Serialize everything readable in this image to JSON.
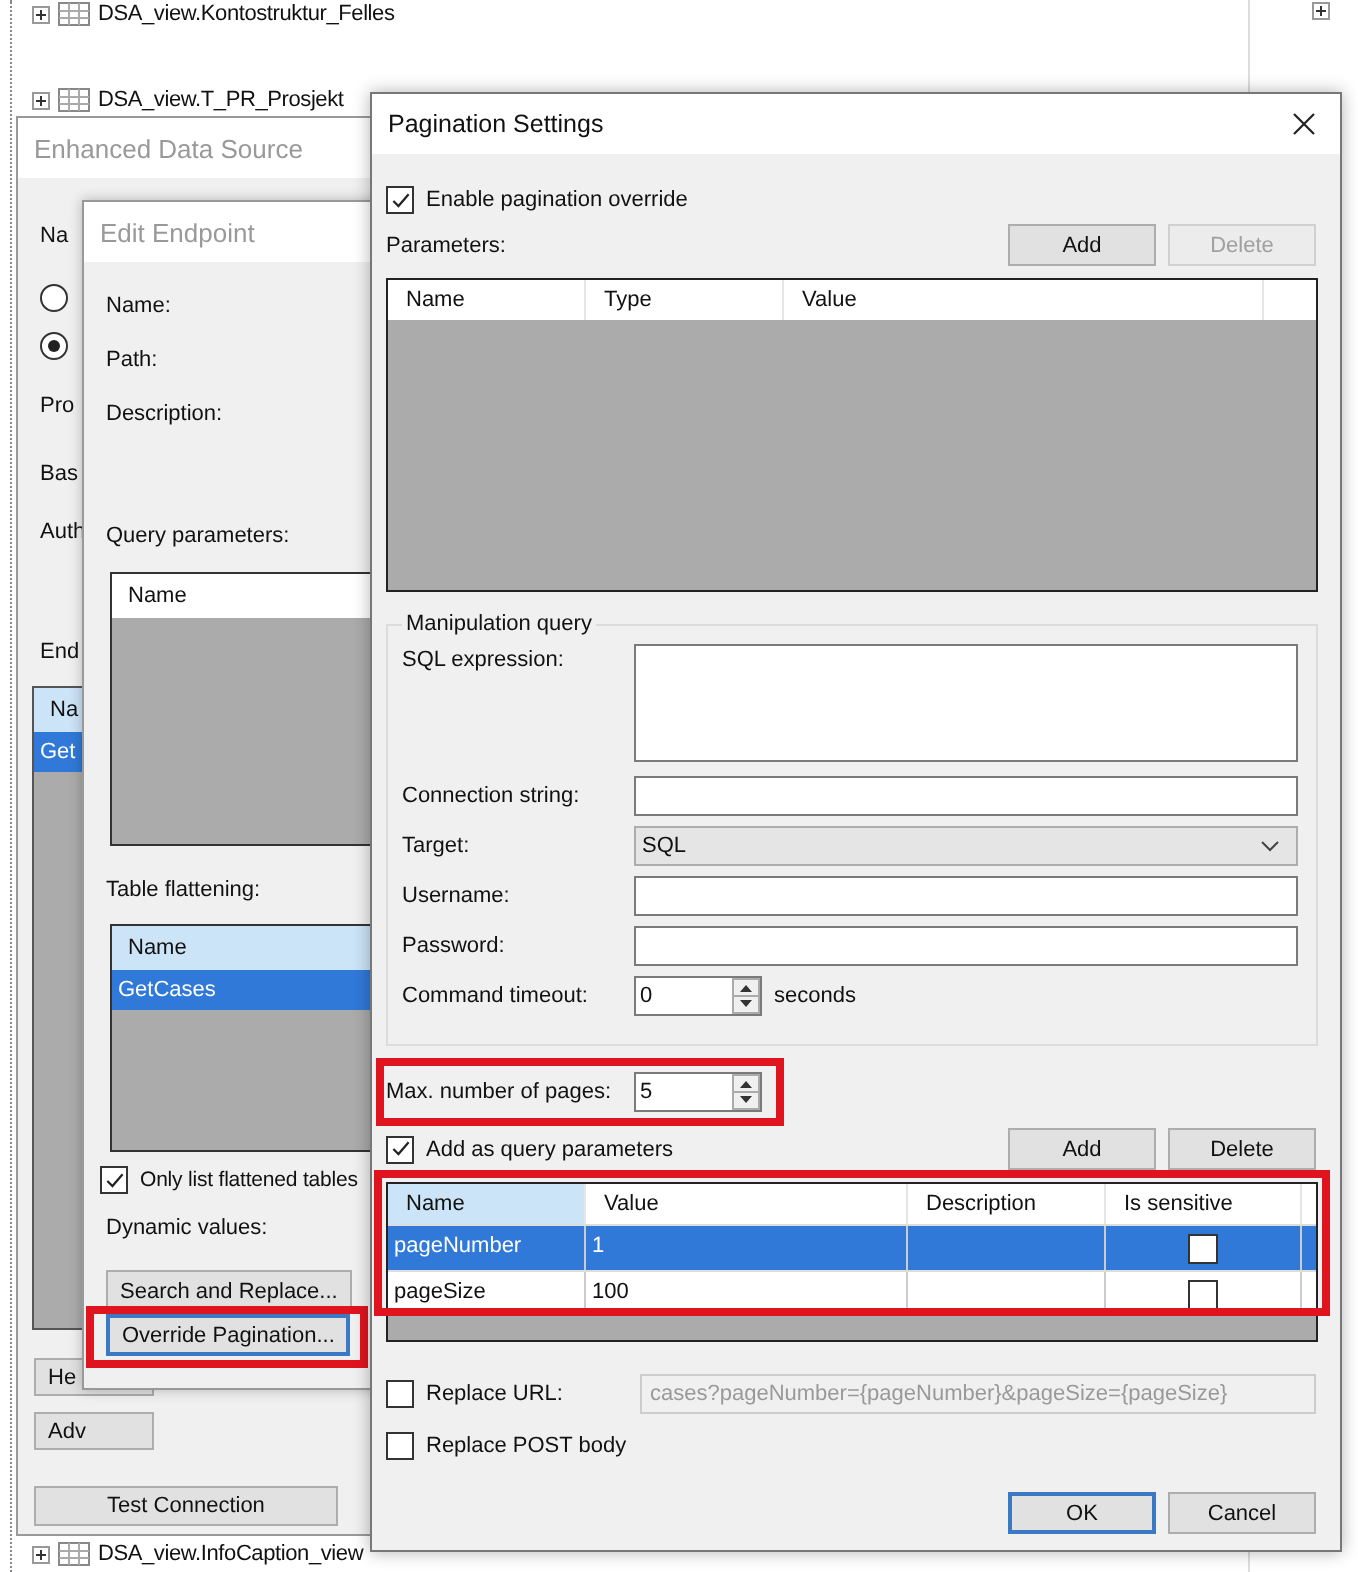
{
  "tree_items": [
    {
      "label": "DSA_view.Kontostruktur_Felles"
    },
    {
      "label": "DSA_view.T_PR_Prosjekt"
    },
    {
      "label": "DSA_view.InfoCaption_view"
    }
  ],
  "enhanced_data_source": {
    "title": "Enhanced Data Source",
    "name_label": "Na",
    "radios": [
      {
        "selected": false
      },
      {
        "selected": true
      }
    ],
    "provider_label": "Pro",
    "base_label": "Bas",
    "auth_label": "Auth",
    "endpoints_label": "End",
    "endpoints": {
      "column": "Na",
      "rows": [
        {
          "name": "Get",
          "selected": true
        }
      ]
    },
    "buttons": [
      "He",
      "Adv"
    ],
    "test_button": "Test Connection"
  },
  "edit_endpoint": {
    "title": "Edit Endpoint",
    "labels": [
      "Name:",
      "Path:",
      "Description:"
    ],
    "query_label": "Query parameters:",
    "query_column": "Name",
    "flattening_label": "Table flattening:",
    "flattening": {
      "column": "Name",
      "rows": [
        {
          "name": "GetCases",
          "selected": true
        }
      ]
    },
    "only_flattened": {
      "label": "Only list flattened tables",
      "checked": true
    },
    "dynamic_label": "Dynamic values:",
    "buttons": [
      {
        "label": "Search and Replace...",
        "highlighted": false
      },
      {
        "label": "Override Pagination...",
        "highlighted": true
      }
    ]
  },
  "pagination_settings": {
    "title": "Pagination Settings",
    "enable_override": {
      "label": "Enable pagination override",
      "checked": true
    },
    "parameters_label": "Parameters:",
    "parameter_buttons": [
      {
        "label": "Add",
        "disabled": false
      },
      {
        "label": "Delete",
        "disabled": true
      }
    ],
    "parameters_table": {
      "columns": [
        "Name",
        "Type",
        "Value"
      ]
    },
    "manipulation_query": {
      "title": "Manipulation query",
      "fields": [
        {
          "kind": "textarea",
          "label": "SQL expression:"
        },
        {
          "kind": "text",
          "label": "Connection string:"
        },
        {
          "kind": "select",
          "label": "Target:",
          "value": "SQL"
        },
        {
          "kind": "text",
          "label": "Username:"
        },
        {
          "kind": "text",
          "label": "Password:"
        },
        {
          "kind": "spinner",
          "label": "Command timeout:",
          "value": "0",
          "unit": "seconds"
        }
      ]
    },
    "max_pages": {
      "label": "Max. number of pages:",
      "value": "5",
      "highlighted": true
    },
    "add_as_query": {
      "label": "Add as query parameters",
      "checked": true
    },
    "query_buttons": [
      {
        "label": "Add",
        "disabled": false
      },
      {
        "label": "Delete",
        "disabled": false
      }
    ],
    "query_table": {
      "highlighted": true,
      "columns": [
        "Name",
        "Value",
        "Description",
        "Is sensitive"
      ],
      "rows": [
        {
          "name": "pageNumber",
          "value": "1",
          "sensitive": false,
          "selected": true
        },
        {
          "name": "pageSize",
          "value": "100",
          "sensitive": false,
          "selected": false
        }
      ]
    },
    "replace_url": {
      "label": "Replace URL:",
      "checked": false,
      "value": "cases?pageNumber={pageNumber}&pageSize={pageSize}"
    },
    "replace_post": {
      "label": "Replace POST body",
      "checked": false
    },
    "dialog_buttons": [
      {
        "label": "OK",
        "default": true
      },
      {
        "label": "Cancel",
        "default": false
      }
    ]
  }
}
